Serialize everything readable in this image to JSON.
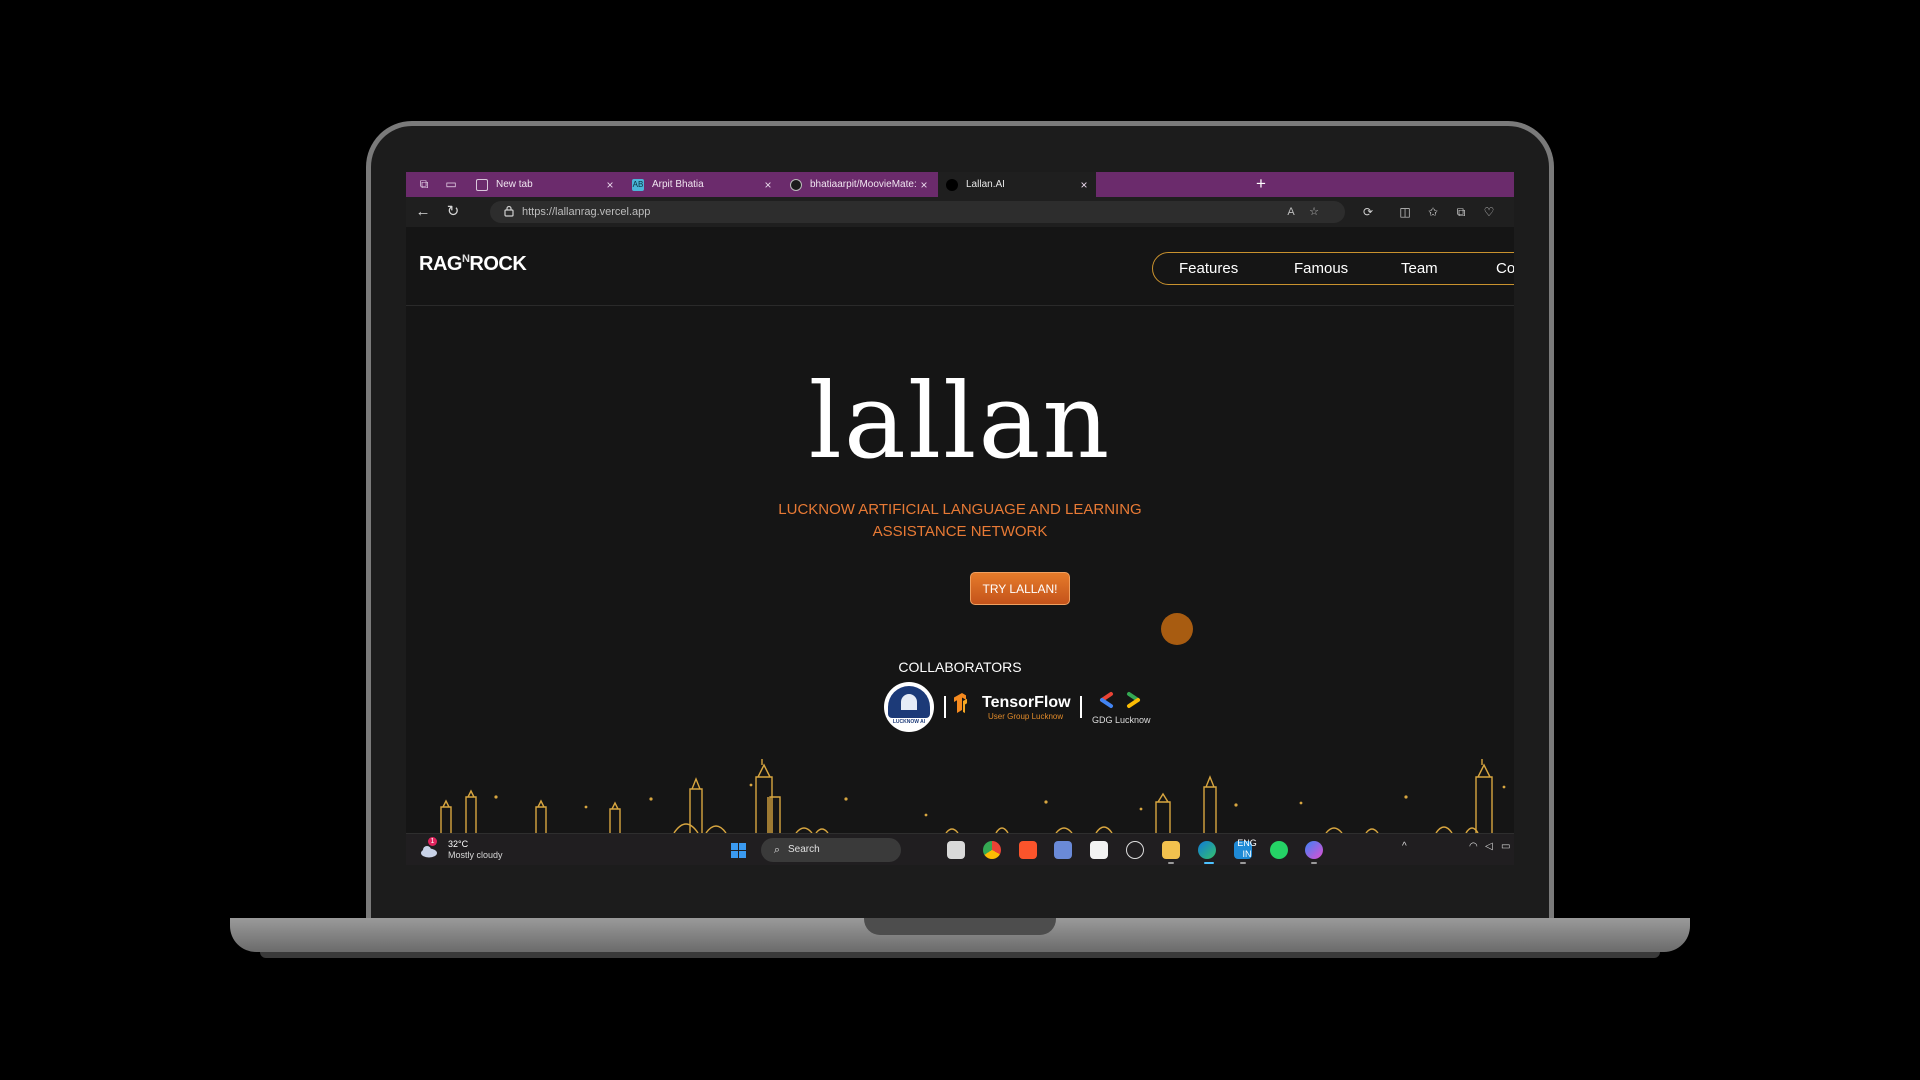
{
  "browser": {
    "tabs": [
      {
        "label": "New tab",
        "favicon": "new-tab-icon"
      },
      {
        "label": "Arpit Bhatia",
        "favicon": "portfolio-icon",
        "favicon_text": "AB"
      },
      {
        "label": "bhatiaarpit/MoovieMate: Moovie",
        "favicon": "github-icon"
      },
      {
        "label": "Lallan.AI",
        "favicon": "lallan-icon"
      }
    ],
    "url": "https://lallanrag.vercel.app"
  },
  "site": {
    "logo": {
      "left": "RAG",
      "mid": "N",
      "right": "ROCK"
    },
    "nav": [
      "Features",
      "Famous",
      "Team",
      "Con"
    ],
    "hero_title": "lallan",
    "hero_subtitle": "LUCKNOW ARTIFICIAL LANGUAGE AND LEARNING ASSISTANCE NETWORK",
    "cta": "TRY LALLAN!",
    "collaborators_title": "COLLABORATORS",
    "collaborators": {
      "lucknow_ai": "LUCKNOW AI",
      "tensorflow": "TensorFlow",
      "tensorflow_sub": "User Group Lucknow",
      "gdg": "GDG Lucknow"
    }
  },
  "taskbar": {
    "weather_badge": "1",
    "temperature": "32°C",
    "condition": "Mostly cloudy",
    "search_label": "Search",
    "lang_line1": "ENG",
    "lang_line2": "IN",
    "apps": [
      "task-view",
      "chrome",
      "brave",
      "snipping-tool",
      "microsoft-store",
      "dell",
      "file-explorer",
      "edge",
      "vscode",
      "whatsapp",
      "copilot"
    ]
  },
  "colors": {
    "tabbar": "#6b2b6c",
    "accent_orange": "#e87a35",
    "nav_border": "#c9922e"
  }
}
